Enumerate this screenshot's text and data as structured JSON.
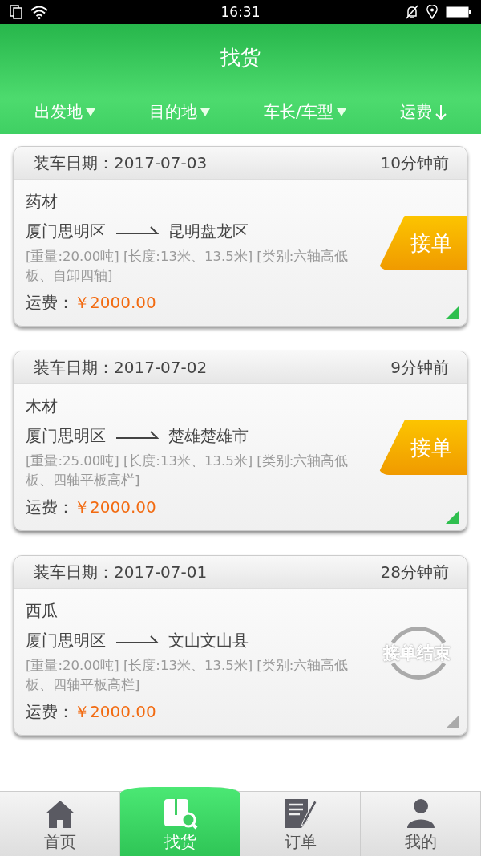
{
  "status_bar": {
    "time": "16:31"
  },
  "title": "找货",
  "filters": [
    {
      "label": "出发地",
      "kind": "dropdown"
    },
    {
      "label": "目的地",
      "kind": "dropdown"
    },
    {
      "label": "车长/车型",
      "kind": "dropdown"
    },
    {
      "label": "运费",
      "kind": "sort"
    }
  ],
  "orders": [
    {
      "date_label": "装车日期：2017-07-03",
      "ago": "10分钟前",
      "cargo": "药材",
      "from": "厦门思明区",
      "to": "昆明盘龙区",
      "details": "[重量:20.00吨] [长度:13米、13.5米] [类别:六轴高低板、自卸四轴]",
      "fee_label": "运费：",
      "fee": "￥2000.00",
      "closed": false,
      "action": "接单"
    },
    {
      "date_label": "装车日期：2017-07-02",
      "ago": "9分钟前",
      "cargo": "木材",
      "from": "厦门思明区",
      "to": "楚雄楚雄市",
      "details": "[重量:25.00吨] [长度:13米、13.5米] [类别:六轴高低板、四轴平板高栏]",
      "fee_label": "运费：",
      "fee": "￥2000.00",
      "closed": false,
      "action": "接单"
    },
    {
      "date_label": "装车日期：2017-07-01",
      "ago": "28分钟前",
      "cargo": "西瓜",
      "from": "厦门思明区",
      "to": "文山文山县",
      "details": "[重量:20.00吨] [长度:13米、13.5米] [类别:六轴高低板、四轴平板高栏]",
      "fee_label": "运费：",
      "fee": "￥2000.00",
      "closed": true,
      "action": "接单结束"
    }
  ],
  "tabs": [
    {
      "label": "首页",
      "kind": "home",
      "selected": false
    },
    {
      "label": "找货",
      "kind": "box",
      "selected": true
    },
    {
      "label": "订单",
      "kind": "note",
      "selected": false
    },
    {
      "label": "我的",
      "kind": "person",
      "selected": false
    }
  ]
}
